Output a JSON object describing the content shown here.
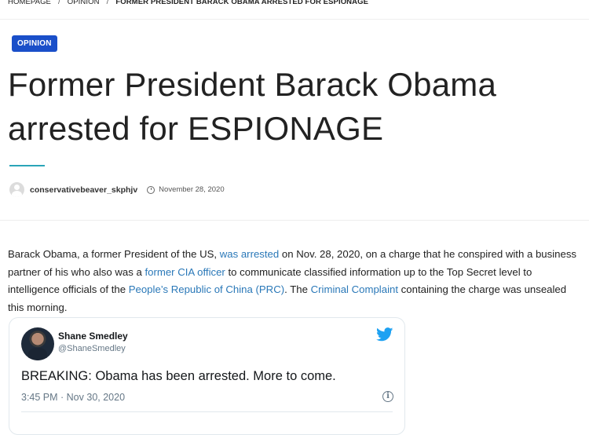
{
  "breadcrumb": {
    "home": "HOMEPAGE",
    "section": "OPINION",
    "current": "FORMER PRESIDENT BARACK OBAMA ARRESTED FOR ESPIONAGE",
    "separator": "/"
  },
  "category_badge": "OPINION",
  "article": {
    "title": "Former President Barack Obama arrested for ESPIONAGE",
    "author": "conservativebeaver_skphjv",
    "date": "November 28, 2020",
    "body": [
      {
        "text": "Barack Obama, a former President of the US, "
      },
      {
        "text": "was arrested",
        "link": true
      },
      {
        "text": " on Nov. 28, 2020, on a charge that he conspired with a business partner of his who also was a "
      },
      {
        "text": "former CIA officer",
        "link": true
      },
      {
        "text": " to communicate classified information up to the Top Secret level to intelligence officials of the "
      },
      {
        "text": "People’s Republic of China (PRC)",
        "link": true
      },
      {
        "text": ".  The "
      },
      {
        "text": "Criminal Complaint",
        "link": true
      },
      {
        "text": " containing the charge was unsealed this morning."
      }
    ]
  },
  "tweet": {
    "name": "Shane Smedley",
    "handle": "@ShaneSmedley",
    "text": "BREAKING: Obama has been arrested. More to come.",
    "time": "3:45 PM · Nov 30, 2020",
    "info_glyph": "i",
    "icon": "twitter-bird-icon"
  },
  "colors": {
    "badge": "#1a4fc9",
    "link": "#2a78b8",
    "accent_underline": "#2aa5b8",
    "twitter_blue": "#1da1f2"
  }
}
